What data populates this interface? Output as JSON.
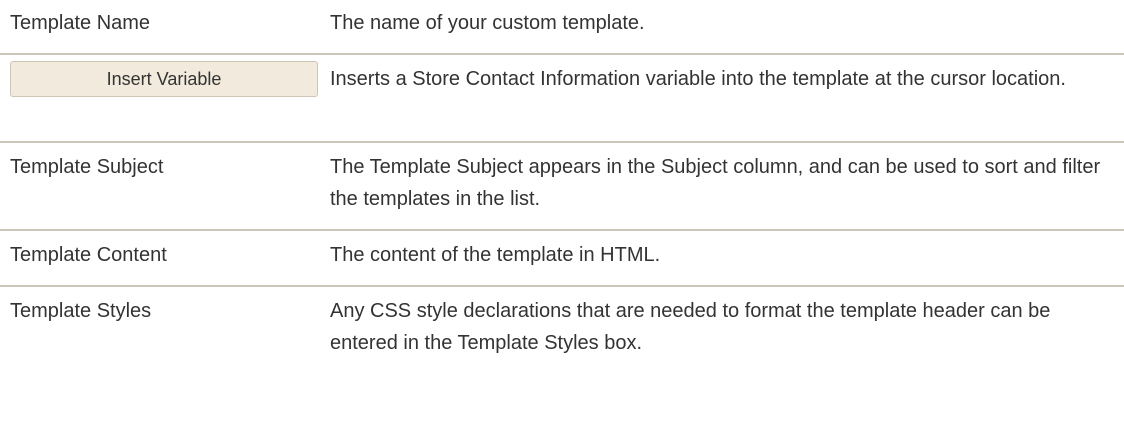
{
  "rows": [
    {
      "field": "Template Name",
      "description": "The name of your custom template."
    },
    {
      "button_label": "Insert Variable",
      "description": "Inserts a Store Contact Information variable into the template at the cursor location."
    },
    {
      "field": "Template Subject",
      "description": "The Template Subject appears in the Subject column, and can be used to sort and filter the templates in the list."
    },
    {
      "field": "Template Content",
      "description": "The content of the template in HTML."
    },
    {
      "field": "Template Styles",
      "description": "Any CSS style declarations that are needed to format the template header can be entered in the Template Styles box."
    }
  ],
  "colors": {
    "text": "#333333",
    "divider": "#cdc5ba",
    "button_bg": "#f2eadc",
    "button_border": "#cfc5b4"
  }
}
